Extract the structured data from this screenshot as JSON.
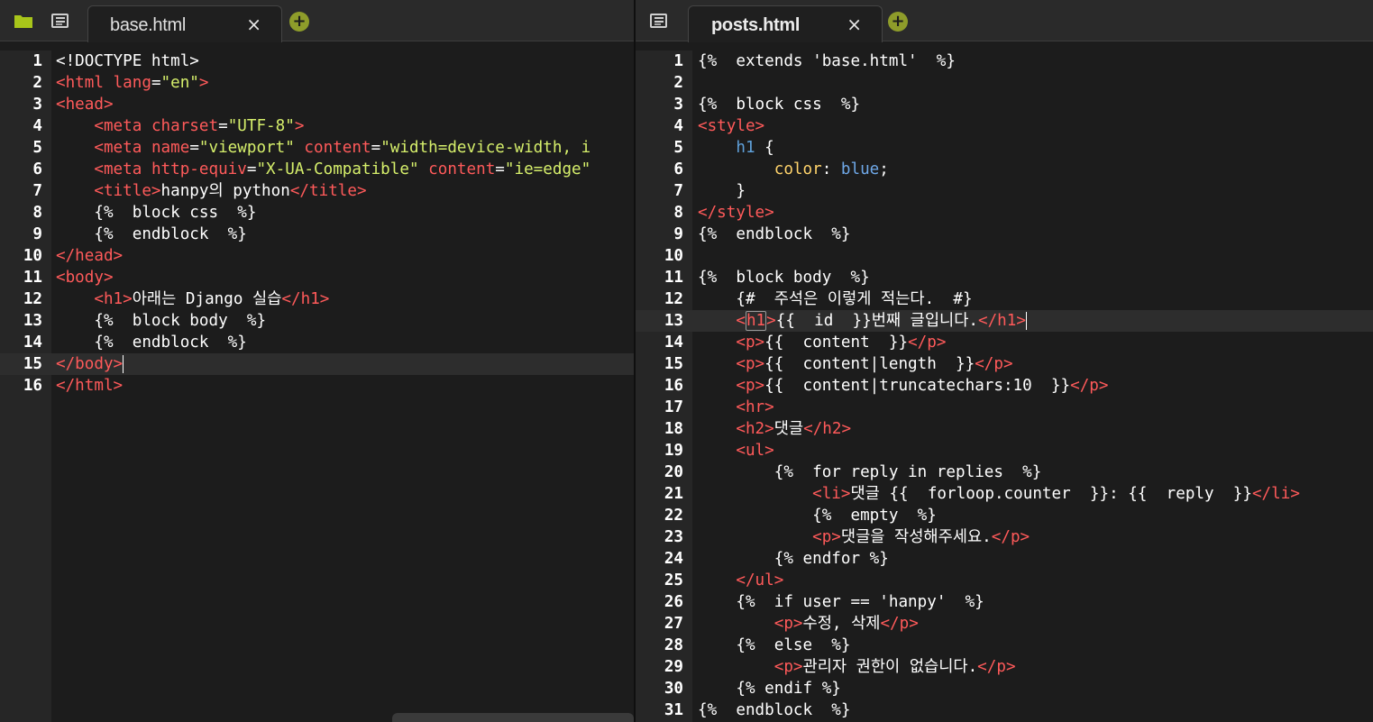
{
  "left_pane": {
    "tab": {
      "label": "base.html",
      "close": "×"
    },
    "add": "+",
    "active_line": 15,
    "lines": [
      {
        "n": "1",
        "tokens": [
          {
            "t": "pl",
            "v": "<!DOCTYPE html>"
          }
        ]
      },
      {
        "n": "2",
        "tokens": [
          {
            "t": "tg",
            "v": "<html "
          },
          {
            "t": "at",
            "v": "lang"
          },
          {
            "t": "pl",
            "v": "="
          },
          {
            "t": "st",
            "v": "\"en\""
          },
          {
            "t": "tg",
            "v": ">"
          }
        ]
      },
      {
        "n": "3",
        "tokens": [
          {
            "t": "tg",
            "v": "<head>"
          }
        ]
      },
      {
        "n": "4",
        "tokens": [
          {
            "t": "ws",
            "v": "    "
          },
          {
            "t": "tg",
            "v": "<meta "
          },
          {
            "t": "at",
            "v": "charset"
          },
          {
            "t": "pl",
            "v": "="
          },
          {
            "t": "st",
            "v": "\"UTF-8\""
          },
          {
            "t": "tg",
            "v": ">"
          }
        ]
      },
      {
        "n": "5",
        "tokens": [
          {
            "t": "ws",
            "v": "    "
          },
          {
            "t": "tg",
            "v": "<meta "
          },
          {
            "t": "at",
            "v": "name"
          },
          {
            "t": "pl",
            "v": "="
          },
          {
            "t": "st",
            "v": "\"viewport\""
          },
          {
            "t": "at",
            "v": " content"
          },
          {
            "t": "pl",
            "v": "="
          },
          {
            "t": "st",
            "v": "\"width=device-width, i"
          }
        ]
      },
      {
        "n": "6",
        "tokens": [
          {
            "t": "ws",
            "v": "    "
          },
          {
            "t": "tg",
            "v": "<meta "
          },
          {
            "t": "at",
            "v": "http-equiv"
          },
          {
            "t": "pl",
            "v": "="
          },
          {
            "t": "st",
            "v": "\"X-UA-Compatible\""
          },
          {
            "t": "at",
            "v": " content"
          },
          {
            "t": "pl",
            "v": "="
          },
          {
            "t": "st",
            "v": "\"ie=edge\""
          }
        ]
      },
      {
        "n": "7",
        "tokens": [
          {
            "t": "ws",
            "v": "    "
          },
          {
            "t": "tg",
            "v": "<title>"
          },
          {
            "t": "pl",
            "v": "hanpy의 python"
          },
          {
            "t": "tg",
            "v": "</title>"
          }
        ]
      },
      {
        "n": "8",
        "tokens": [
          {
            "t": "ws",
            "v": "    "
          },
          {
            "t": "tp",
            "v": "{%  block css  %}"
          }
        ]
      },
      {
        "n": "9",
        "tokens": [
          {
            "t": "ws",
            "v": "    "
          },
          {
            "t": "tp",
            "v": "{%  endblock  %}"
          }
        ]
      },
      {
        "n": "10",
        "tokens": [
          {
            "t": "tg",
            "v": "</head>"
          }
        ]
      },
      {
        "n": "11",
        "tokens": [
          {
            "t": "tg",
            "v": "<body>"
          }
        ]
      },
      {
        "n": "12",
        "tokens": [
          {
            "t": "ws",
            "v": "    "
          },
          {
            "t": "tg",
            "v": "<h1>"
          },
          {
            "t": "pl",
            "v": "아래는 Django 실습"
          },
          {
            "t": "tg",
            "v": "</h1>"
          }
        ]
      },
      {
        "n": "13",
        "tokens": [
          {
            "t": "ws",
            "v": "    "
          },
          {
            "t": "tp",
            "v": "{%  block body  %}"
          }
        ]
      },
      {
        "n": "14",
        "tokens": [
          {
            "t": "ws",
            "v": "    "
          },
          {
            "t": "tp",
            "v": "{%  endblock  %}"
          }
        ]
      },
      {
        "n": "15",
        "tokens": [
          {
            "t": "tg",
            "v": "</body>"
          },
          {
            "t": "caret",
            "v": ""
          }
        ]
      },
      {
        "n": "16",
        "tokens": [
          {
            "t": "tg",
            "v": "</html>"
          }
        ]
      }
    ]
  },
  "right_pane": {
    "tab": {
      "label": "posts.html",
      "close": "×"
    },
    "add": "+",
    "active_line": 13,
    "lines": [
      {
        "n": "1",
        "tokens": [
          {
            "t": "tp",
            "v": "{%  extends 'base.html'  %}"
          }
        ]
      },
      {
        "n": "2",
        "tokens": []
      },
      {
        "n": "3",
        "tokens": [
          {
            "t": "tp",
            "v": "{%  block css  %}"
          }
        ]
      },
      {
        "n": "4",
        "tokens": [
          {
            "t": "tg",
            "v": "<style>"
          }
        ]
      },
      {
        "n": "5",
        "tokens": [
          {
            "t": "ws",
            "v": "    "
          },
          {
            "t": "sel",
            "v": "h1"
          },
          {
            "t": "pl",
            "v": " {"
          }
        ]
      },
      {
        "n": "6",
        "tokens": [
          {
            "t": "ws",
            "v": "        "
          },
          {
            "t": "prop",
            "v": "color"
          },
          {
            "t": "pl",
            "v": ": "
          },
          {
            "t": "val",
            "v": "blue"
          },
          {
            "t": "pl",
            "v": ";"
          }
        ]
      },
      {
        "n": "7",
        "tokens": [
          {
            "t": "ws",
            "v": "    "
          },
          {
            "t": "pl",
            "v": "}"
          }
        ]
      },
      {
        "n": "8",
        "tokens": [
          {
            "t": "tg",
            "v": "</style>"
          }
        ]
      },
      {
        "n": "9",
        "tokens": [
          {
            "t": "tp",
            "v": "{%  endblock  %}"
          }
        ]
      },
      {
        "n": "10",
        "tokens": []
      },
      {
        "n": "11",
        "tokens": [
          {
            "t": "tp",
            "v": "{%  block body  %}"
          }
        ]
      },
      {
        "n": "12",
        "tokens": [
          {
            "t": "ws",
            "v": "    "
          },
          {
            "t": "tp",
            "v": "{#  주석은 이렇게 적는다.  #}"
          }
        ]
      },
      {
        "n": "13",
        "tokens": [
          {
            "t": "ws",
            "v": "    "
          },
          {
            "t": "tg",
            "v": "<"
          },
          {
            "t": "tgbox",
            "v": "h1"
          },
          {
            "t": "tg",
            "v": ">"
          },
          {
            "t": "tp",
            "v": "{{  id  }}"
          },
          {
            "t": "pl",
            "v": "번째 글입니다."
          },
          {
            "t": "tg",
            "v": "</h1>"
          },
          {
            "t": "caret",
            "v": ""
          }
        ]
      },
      {
        "n": "14",
        "tokens": [
          {
            "t": "ws",
            "v": "    "
          },
          {
            "t": "tg",
            "v": "<p>"
          },
          {
            "t": "tp",
            "v": "{{  content  }}"
          },
          {
            "t": "tg",
            "v": "</p>"
          }
        ]
      },
      {
        "n": "15",
        "tokens": [
          {
            "t": "ws",
            "v": "    "
          },
          {
            "t": "tg",
            "v": "<p>"
          },
          {
            "t": "tp",
            "v": "{{  content|length  }}"
          },
          {
            "t": "tg",
            "v": "</p>"
          }
        ]
      },
      {
        "n": "16",
        "tokens": [
          {
            "t": "ws",
            "v": "    "
          },
          {
            "t": "tg",
            "v": "<p>"
          },
          {
            "t": "tp",
            "v": "{{  content|truncatechars:10  }}"
          },
          {
            "t": "tg",
            "v": "</p>"
          }
        ]
      },
      {
        "n": "17",
        "tokens": [
          {
            "t": "ws",
            "v": "    "
          },
          {
            "t": "tg",
            "v": "<hr>"
          }
        ]
      },
      {
        "n": "18",
        "tokens": [
          {
            "t": "ws",
            "v": "    "
          },
          {
            "t": "tg",
            "v": "<h2>"
          },
          {
            "t": "pl",
            "v": "댓글"
          },
          {
            "t": "tg",
            "v": "</h2>"
          }
        ]
      },
      {
        "n": "19",
        "tokens": [
          {
            "t": "ws",
            "v": "    "
          },
          {
            "t": "tg",
            "v": "<ul>"
          }
        ]
      },
      {
        "n": "20",
        "tokens": [
          {
            "t": "ws",
            "v": "        "
          },
          {
            "t": "tp",
            "v": "{%  for reply in replies  %}"
          }
        ]
      },
      {
        "n": "21",
        "tokens": [
          {
            "t": "ws",
            "v": "            "
          },
          {
            "t": "tg",
            "v": "<li>"
          },
          {
            "t": "pl",
            "v": "댓글 "
          },
          {
            "t": "tp",
            "v": "{{  forloop.counter  }}: {{  reply  }}"
          },
          {
            "t": "tg",
            "v": "</li>"
          }
        ]
      },
      {
        "n": "22",
        "tokens": [
          {
            "t": "ws",
            "v": "            "
          },
          {
            "t": "tp",
            "v": "{%  empty  %}"
          }
        ]
      },
      {
        "n": "23",
        "tokens": [
          {
            "t": "ws",
            "v": "            "
          },
          {
            "t": "tg",
            "v": "<p>"
          },
          {
            "t": "pl",
            "v": "댓글을 작성해주세요."
          },
          {
            "t": "tg",
            "v": "</p>"
          }
        ]
      },
      {
        "n": "24",
        "tokens": [
          {
            "t": "ws",
            "v": "        "
          },
          {
            "t": "tp",
            "v": "{% endfor %}"
          }
        ]
      },
      {
        "n": "25",
        "tokens": [
          {
            "t": "ws",
            "v": "    "
          },
          {
            "t": "tg",
            "v": "</ul>"
          }
        ]
      },
      {
        "n": "26",
        "tokens": [
          {
            "t": "ws",
            "v": "    "
          },
          {
            "t": "tp",
            "v": "{%  if user == 'hanpy'  %}"
          }
        ]
      },
      {
        "n": "27",
        "tokens": [
          {
            "t": "ws",
            "v": "        "
          },
          {
            "t": "tg",
            "v": "<p>"
          },
          {
            "t": "pl",
            "v": "수정, 삭제"
          },
          {
            "t": "tg",
            "v": "</p>"
          }
        ]
      },
      {
        "n": "28",
        "tokens": [
          {
            "t": "ws",
            "v": "    "
          },
          {
            "t": "tp",
            "v": "{%  else  %}"
          }
        ]
      },
      {
        "n": "29",
        "tokens": [
          {
            "t": "ws",
            "v": "        "
          },
          {
            "t": "tg",
            "v": "<p>"
          },
          {
            "t": "pl",
            "v": "관리자 권한이 없습니다."
          },
          {
            "t": "tg",
            "v": "</p>"
          }
        ]
      },
      {
        "n": "30",
        "tokens": [
          {
            "t": "ws",
            "v": "    "
          },
          {
            "t": "tp",
            "v": "{% endif %}"
          }
        ]
      },
      {
        "n": "31",
        "tokens": [
          {
            "t": "tp",
            "v": "{%  endblock  %}"
          }
        ]
      }
    ]
  }
}
